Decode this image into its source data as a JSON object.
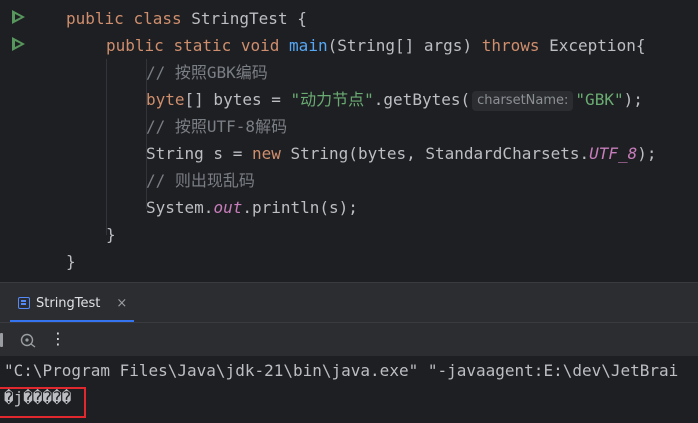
{
  "editor": {
    "lines": {
      "l1": {
        "kw1": "public",
        "kw2": "class",
        "name": " StringTest {"
      },
      "l2": {
        "kw1": "public",
        "kw2": "static",
        "kw3": "void",
        "method": "main",
        "params": "(String[] args) ",
        "kw4": "throws",
        "rest": " Exception{"
      },
      "l3": {
        "comment": "// 按照GBK编码"
      },
      "l4": {
        "kw": "byte",
        "mid": "[] bytes = ",
        "str": "\"动力节点\"",
        "call": ".getBytes(",
        "hint": "charsetName:",
        "arg": "\"GBK\"",
        "end": ");"
      },
      "l5": {
        "comment": "// 按照UTF-8解码"
      },
      "l6": {
        "pre": "String s = ",
        "kw": "new",
        "mid": " String(bytes, StandardCharsets.",
        "const": "UTF_8",
        "end": ");"
      },
      "l7": {
        "comment": "// 则出现乱码"
      },
      "l8": {
        "pre": "System.",
        "field": "out",
        "end": ".println(s);"
      },
      "l9": {
        "text": "}"
      },
      "l10": {
        "text": "}"
      }
    }
  },
  "run_panel": {
    "tab_label": "StringTest",
    "close_glyph": "×",
    "more_glyph": "⋮"
  },
  "console": {
    "command": "\"C:\\Program Files\\Java\\jdk-21\\bin\\java.exe\" \"-javaagent:E:\\dev\\JetBrai",
    "output": "�j�����"
  },
  "colors": {
    "keyword": "#cf8e6d",
    "method": "#56a8f5",
    "string": "#6aab73",
    "comment": "#7a7e85",
    "static_field": "#c77dbb",
    "run_gutter": "#57965c",
    "tab_accent": "#3574f0",
    "highlight": "#e0282e"
  }
}
